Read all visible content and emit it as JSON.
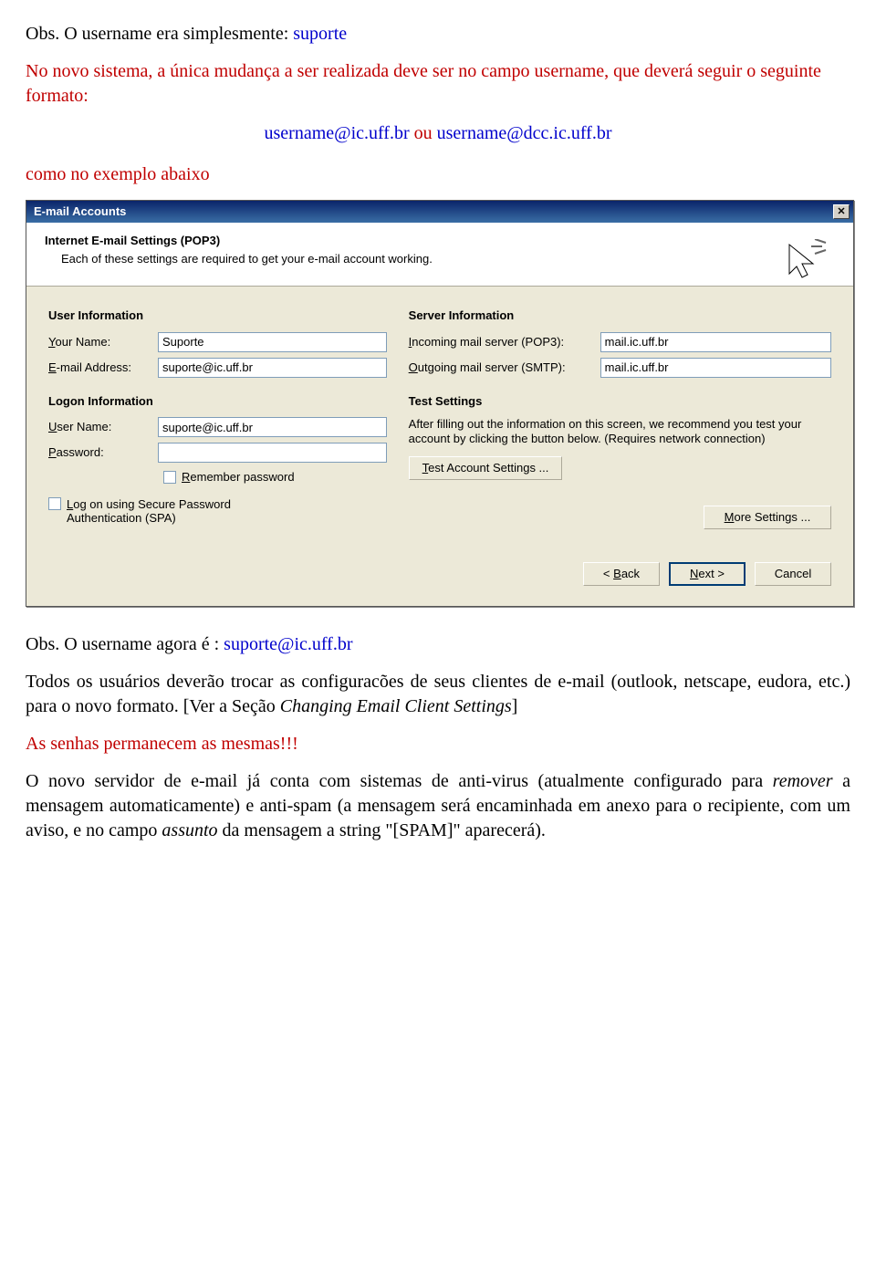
{
  "doc": {
    "p1_pre": "Obs. O username era simplesmente:  ",
    "p1_user": "suporte",
    "p2": "No novo sistema, a única mudança a ser realizada deve ser no campo username, que deverá seguir o seguinte formato:",
    "fmt_left": "username@ic.uff.br",
    "fmt_mid": "   ou   ",
    "fmt_right": "username@dcc.ic.uff.br",
    "p3": "como no exemplo abaixo",
    "p4_pre": "Obs. O username agora é :    ",
    "p4_user": "suporte@ic.uff.br",
    "p5": "Todos os usuários deverão trocar as configuracões de seus clientes de e-mail (outlook, netscape, eudora, etc.) para o novo formato. [Ver a Seção ",
    "p5_italic": "Changing Email Client Settings",
    "p5_end": "]",
    "p6": "As senhas permanecem as mesmas!!!",
    "p7a": "O novo servidor de e-mail já conta com sistemas de anti-virus (atualmente configurado para ",
    "p7_rem": "remover",
    "p7b": " a mensagem automaticamente) e anti-spam (a mensagem será encaminhada em anexo para o recipiente, com um aviso, e no campo ",
    "p7_ass": "assunto",
    "p7c": " da mensagem a string \"[SPAM]\" aparecerá)."
  },
  "dlg": {
    "title": "E-mail Accounts",
    "head_h1": "Internet E-mail Settings (POP3)",
    "head_sub": "Each of these settings are required to get your e-mail account working.",
    "user_info_h": "User Information",
    "server_info_h": "Server Information",
    "logon_info_h": "Logon Information",
    "test_h": "Test Settings",
    "lbl_name": "Your Name:",
    "lbl_email": "E-mail Address:",
    "lbl_pop3": "Incoming mail server (POP3):",
    "lbl_smtp": "Outgoing mail server (SMTP):",
    "lbl_user": "User Name:",
    "lbl_pass": "Password:",
    "val_name": "Suporte",
    "val_email": "suporte@ic.uff.br",
    "val_pop3": "mail.ic.uff.br",
    "val_smtp": "mail.ic.uff.br",
    "val_user": "suporte@ic.uff.br",
    "val_pass": "",
    "remember": "Remember password",
    "spa_a": "Log on using Secure Password",
    "spa_b": "Authentication (SPA)",
    "test_desc": "After filling out the information on this screen, we recommend you test your account by clicking the button below. (Requires network connection)",
    "btn_test": "Test Account Settings ...",
    "btn_more": "More Settings ...",
    "btn_back": "< Back",
    "btn_next": "Next >",
    "btn_cancel": "Cancel"
  }
}
